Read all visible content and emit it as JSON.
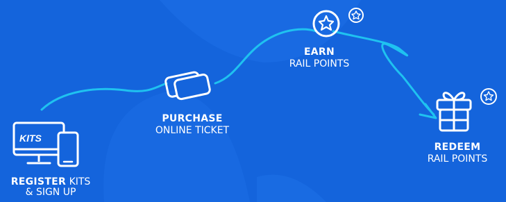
{
  "steps": {
    "register": {
      "title_bold": "REGISTER",
      "title_light": "KITS",
      "subtitle": "& SIGN UP",
      "icon": "computer-phone-kits-icon",
      "icon_text": "KITS"
    },
    "purchase": {
      "title_bold": "PURCHASE",
      "subtitle": "ONLINE TICKET",
      "icon": "ticket-icon"
    },
    "earn": {
      "title_bold": "EARN",
      "subtitle": "RAIL POINTS",
      "icon": "star-badge-icon"
    },
    "redeem": {
      "title_bold": "REDEEM",
      "subtitle": "RAIL POINTS",
      "icon": "gift-icon"
    }
  },
  "colors": {
    "background": "#1464dc",
    "background_shape": "#1f73e8",
    "path": "#1fc2f0",
    "text": "#ffffff"
  }
}
